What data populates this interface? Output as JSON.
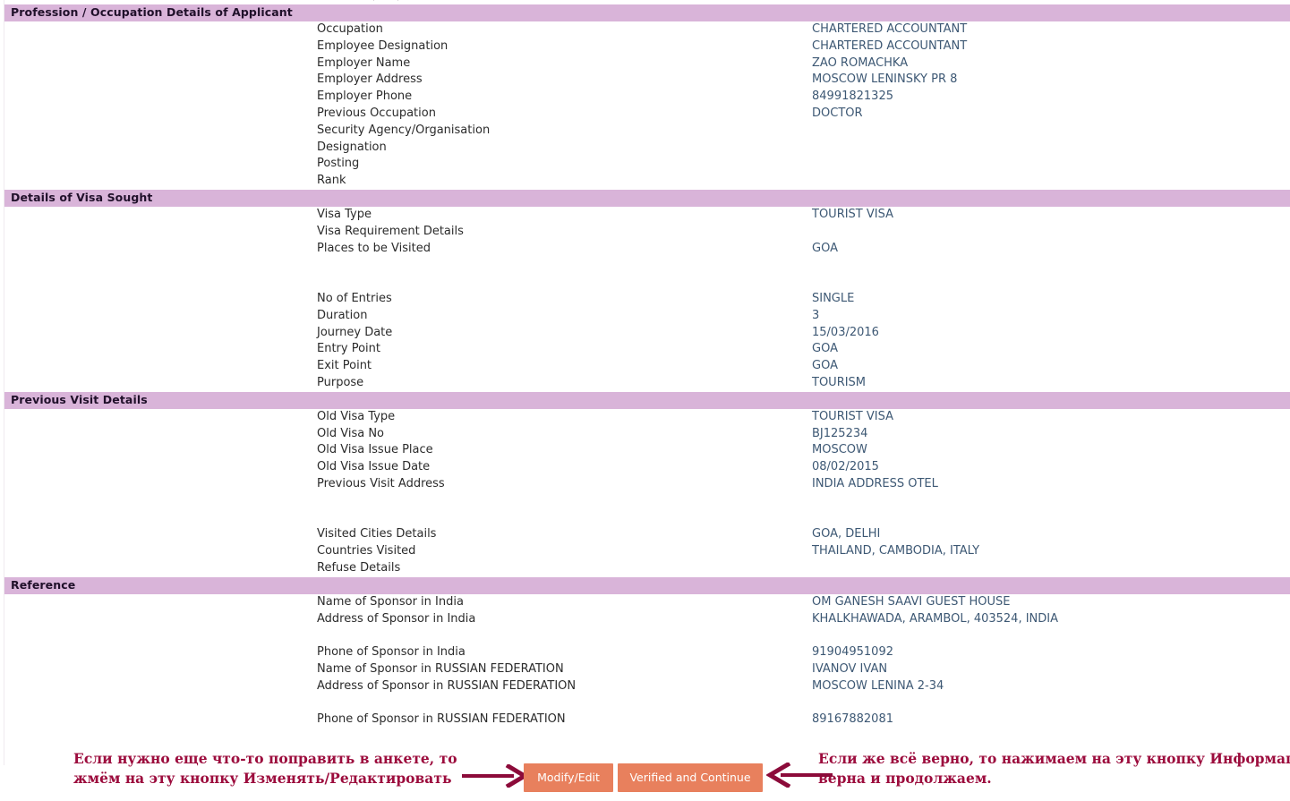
{
  "sections": [
    {
      "id": "profession",
      "title": "Profession / Occupation Details of Applicant",
      "rows": [
        {
          "label": "Occupation",
          "value": "CHARTERED ACCOUNTANT"
        },
        {
          "label": "Employee Designation",
          "value": "CHARTERED ACCOUNTANT"
        },
        {
          "label": "Employer Name",
          "value": "ZAO ROMACHKA"
        },
        {
          "label": "Employer Address",
          "value": "MOSCOW LENINSKY PR 8"
        },
        {
          "label": "Employer Phone",
          "value": "84991821325"
        },
        {
          "label": "Previous Occupation",
          "value": "DOCTOR"
        },
        {
          "label": "Security Agency/Organisation",
          "value": ""
        },
        {
          "label": "Designation",
          "value": ""
        },
        {
          "label": "Posting",
          "value": ""
        },
        {
          "label": "Rank",
          "value": ""
        }
      ]
    },
    {
      "id": "visa-sought",
      "title": "Details of Visa Sought",
      "rows": [
        {
          "label": "Visa Type",
          "value": "TOURIST VISA"
        },
        {
          "label": "Visa Requirement Details",
          "value": ""
        },
        {
          "label": "Places to be Visited",
          "value": "GOA"
        },
        {
          "label": "",
          "value": ""
        },
        {
          "label": "",
          "value": ""
        },
        {
          "label": "No of Entries",
          "value": "SINGLE"
        },
        {
          "label": "Duration",
          "value": "3"
        },
        {
          "label": "Journey Date",
          "value": "15/03/2016"
        },
        {
          "label": "Entry Point",
          "value": "GOA"
        },
        {
          "label": "Exit Point",
          "value": "GOA"
        },
        {
          "label": "Purpose",
          "value": "TOURISM"
        }
      ]
    },
    {
      "id": "previous-visit",
      "title": "Previous Visit Details",
      "rows": [
        {
          "label": "Old Visa Type",
          "value": "TOURIST VISA"
        },
        {
          "label": "Old Visa No",
          "value": "BJ125234"
        },
        {
          "label": "Old Visa Issue Place",
          "value": "MOSCOW"
        },
        {
          "label": "Old Visa Issue Date",
          "value": "08/02/2015"
        },
        {
          "label": "Previous Visit Address",
          "value": "INDIA ADDRESS OTEL"
        },
        {
          "label": "",
          "value": ""
        },
        {
          "label": "",
          "value": ""
        },
        {
          "label": "Visited Cities Details",
          "value": "GOA, DELHI"
        },
        {
          "label": "Countries Visited",
          "value": "THAILAND, CAMBODIA, ITALY"
        },
        {
          "label": "Refuse Details",
          "value": ""
        }
      ]
    },
    {
      "id": "reference",
      "title": "Reference",
      "rows": [
        {
          "label": "Name of Sponsor in India",
          "value": "OM GANESH SAAVI GUEST HOUSE"
        },
        {
          "label": "Address of Sponsor in India",
          "value": "KHALKHAWADA, ARAMBOL, 403524, INDIA"
        },
        {
          "label": "",
          "value": ""
        },
        {
          "label": "Phone of Sponsor in India",
          "value": "91904951092"
        },
        {
          "label": "Name of Sponsor in RUSSIAN FEDERATION",
          "value": "IVANOV IVAN"
        },
        {
          "label": "Address of Sponsor in RUSSIAN FEDERATION",
          "value": "MOSCOW LENINA 2-34"
        },
        {
          "label": "",
          "value": ""
        },
        {
          "label": "Phone of Sponsor in RUSSIAN FEDERATION",
          "value": "89167882081"
        }
      ]
    }
  ],
  "footer": {
    "note_left_line1": "Если нужно еще что-то поправить в анкете, то",
    "note_left_line2": "жмём на эту кнопку Изменять/Редактировать",
    "note_right_line1": "Если же всё верно, то нажимаем на эту кнопку Информация",
    "note_right_line2": "верна и продолжаем.",
    "modify_label": "Modify/Edit",
    "verified_label": "Verified and Continue"
  },
  "colors": {
    "section_header_bg": "#d9b4d9",
    "section_header_text": "#20102a",
    "label_text": "#2b2b2b",
    "value_text": "#3d5874",
    "button_bg": "#e8805d",
    "button_text": "#ffffff",
    "annotation_text": "#9c0c3d",
    "arrow": "#8c0b3a"
  }
}
